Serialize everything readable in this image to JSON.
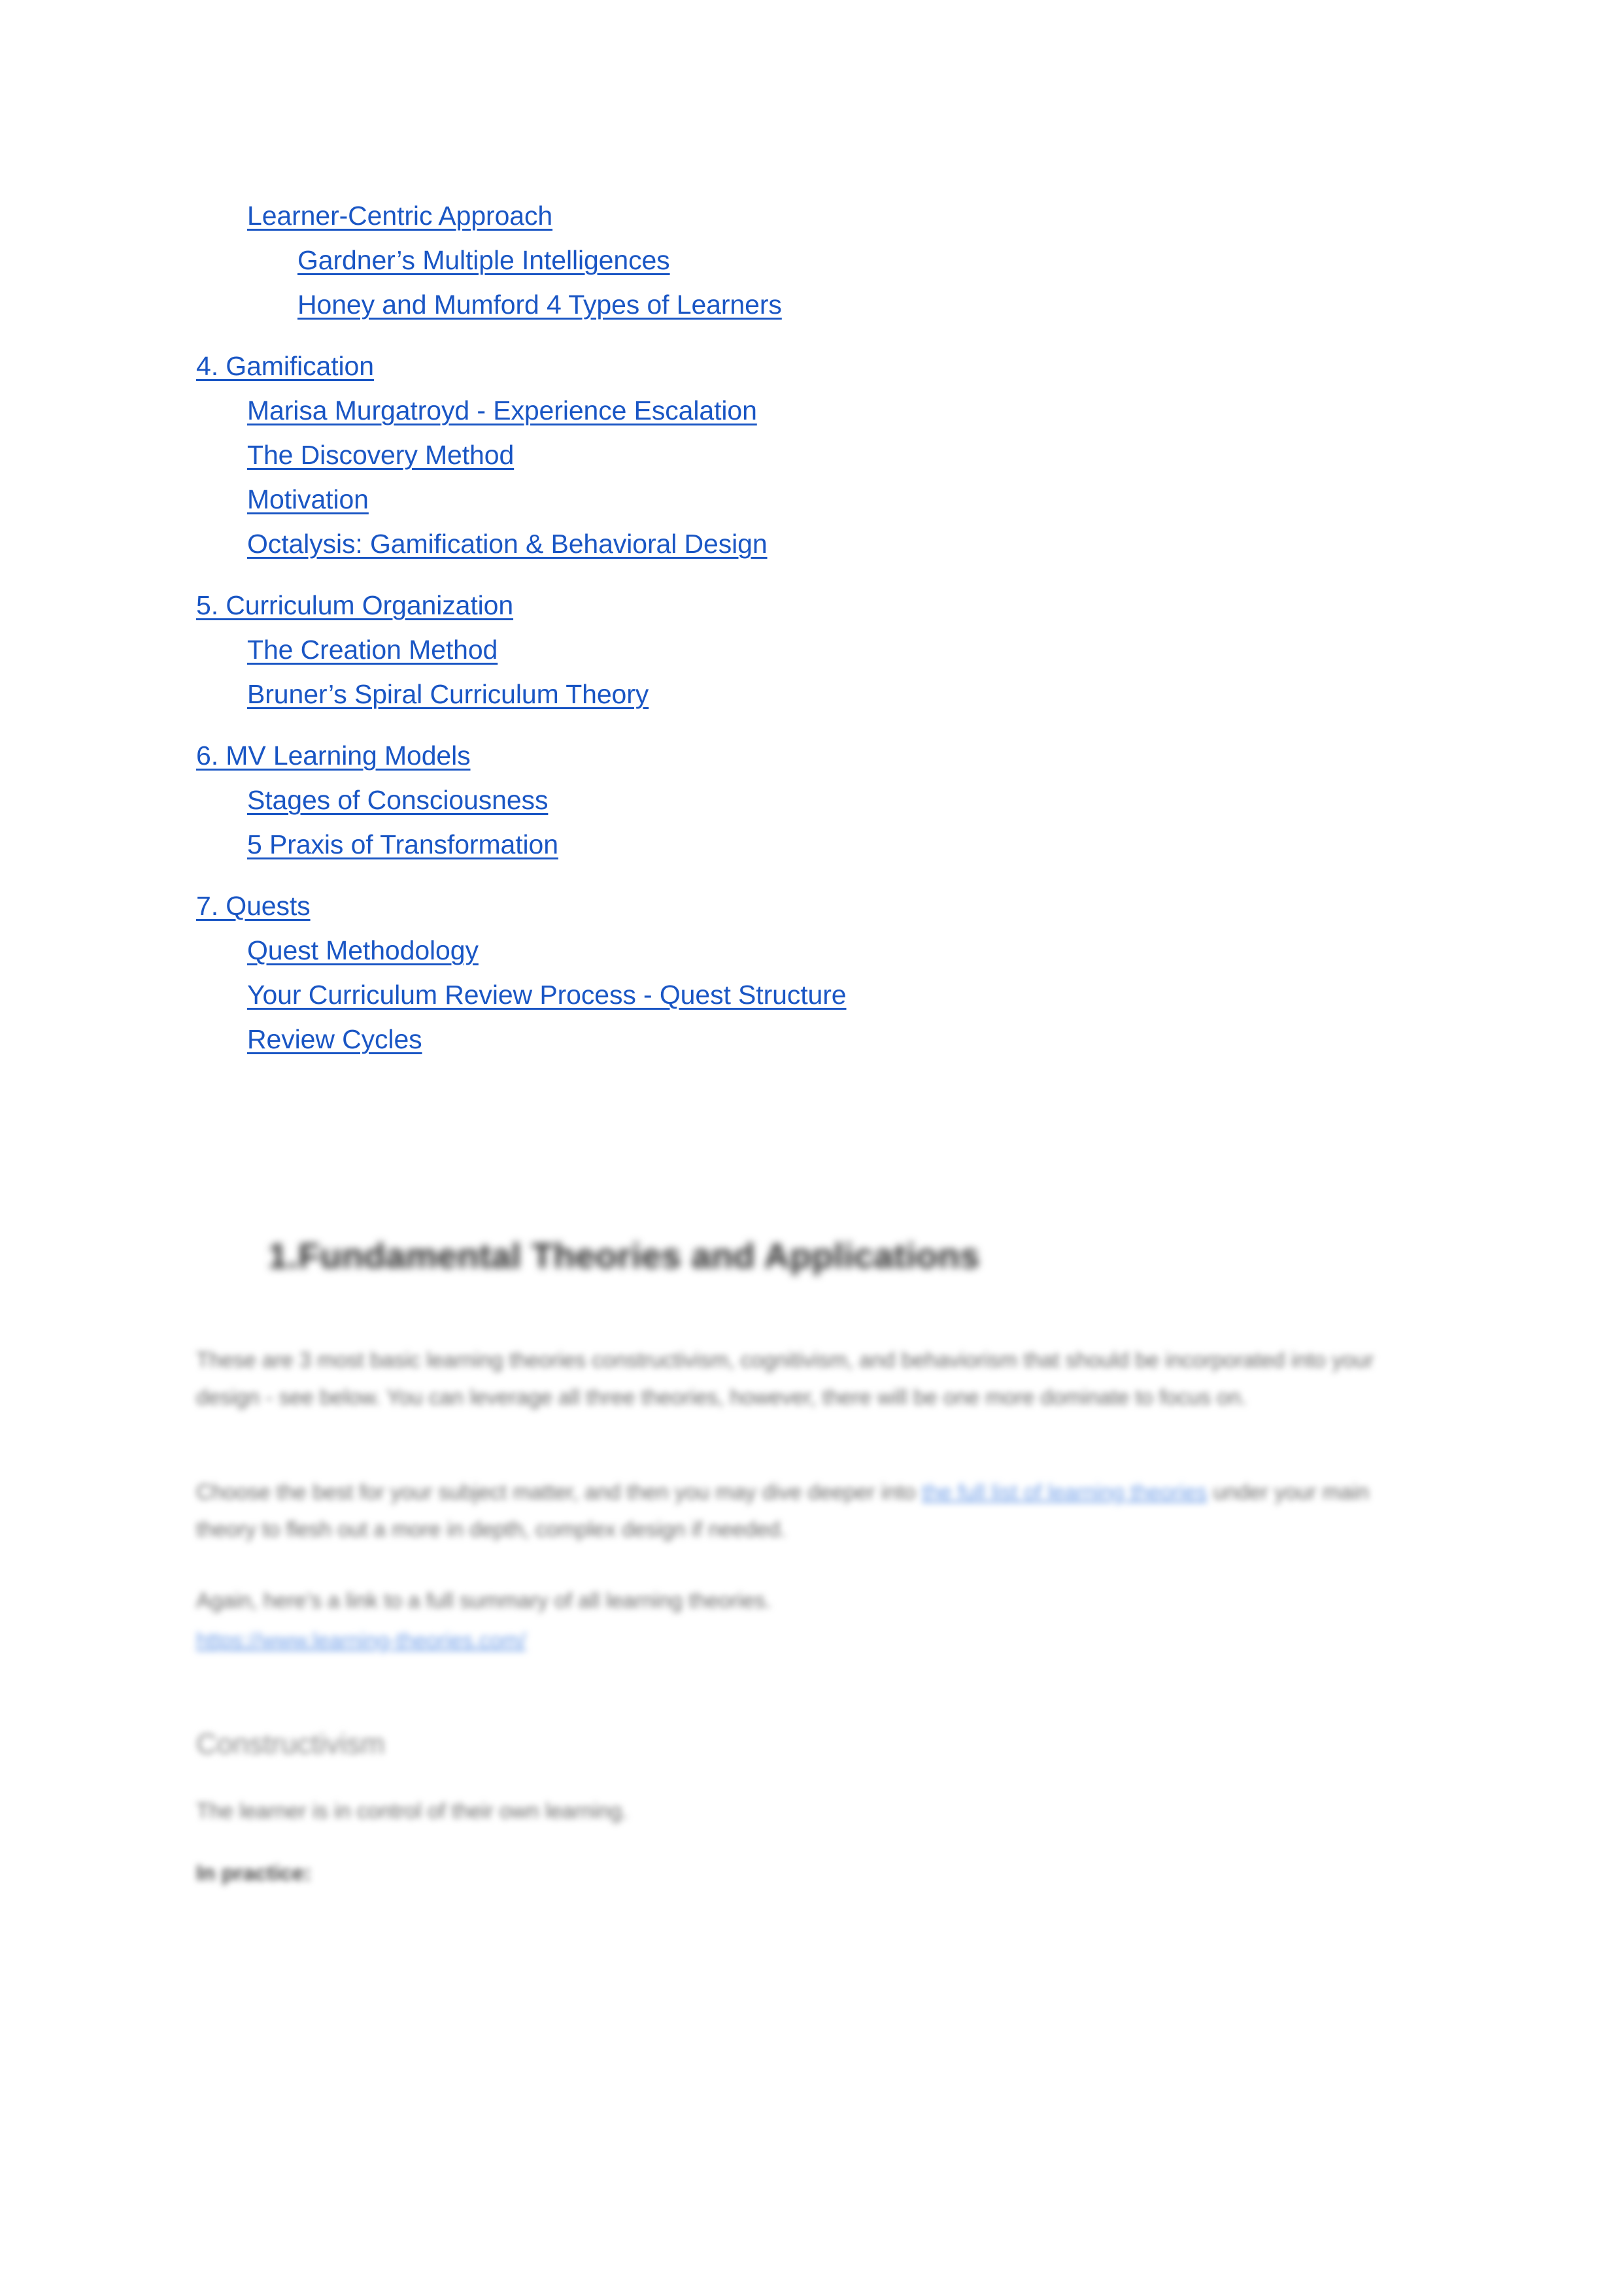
{
  "document": {
    "link_color": "#1a56c4",
    "background_color": "#ffffff",
    "body_text_color": "#6a6a6a"
  },
  "toc": {
    "groups": [
      {
        "items": [
          {
            "label": "Learner-Centric Approach",
            "level": 2
          },
          {
            "label": "Gardner’s Multiple Intelligences",
            "level": 3
          },
          {
            "label": "Honey and Mumford 4 Types of Learners",
            "level": 3
          }
        ]
      },
      {
        "items": [
          {
            "label": "4. Gamification",
            "level": 1
          },
          {
            "label": "Marisa Murgatroyd - Experience Escalation",
            "level": 2
          },
          {
            "label": "The Discovery Method",
            "level": 2
          },
          {
            "label": "Motivation",
            "level": 2
          },
          {
            "label": "Octalysis: Gamification & Behavioral Design",
            "level": 2
          }
        ]
      },
      {
        "items": [
          {
            "label": "5. Curriculum Organization",
            "level": 1
          },
          {
            "label": "The Creation Method",
            "level": 2
          },
          {
            "label": "Bruner’s Spiral Curriculum Theory",
            "level": 2
          }
        ]
      },
      {
        "items": [
          {
            "label": "6. MV Learning Models",
            "level": 1
          },
          {
            "label": "Stages of Consciousness",
            "level": 2
          },
          {
            "label": "5 Praxis of Transformation",
            "level": 2
          }
        ]
      },
      {
        "items": [
          {
            "label": "7. Quests",
            "level": 1
          },
          {
            "label": "Quest Methodology",
            "level": 2
          },
          {
            "label": "Your Curriculum Review Process - Quest Structure",
            "level": 2
          },
          {
            "label": "Review Cycles",
            "level": 2
          }
        ]
      }
    ]
  },
  "body": {
    "heading": "1.Fundamental Theories and Applications",
    "paragraph_1": "These are 3 most basic learning theories constructivism, cognitivism, and behaviorism that should be incorporated into your design - see below. You can leverage all three theories, however, there will be one more dominate to focus on.",
    "paragraph_2_before_link": "Choose the best for your subject matter, and then you may dive deeper into ",
    "paragraph_2_link": "the full list of learning theories",
    "paragraph_2_after_link": " under your main theory to flesh out a more in depth, complex design if needed.",
    "bold_note": "Again, here’s a link to a full summary of all learning theories.",
    "url": "https://www.learning-theories.com/",
    "subheading": "Constructivism",
    "subheading_line": "The learner is in control of their own learning.",
    "in_practice_label": "In practice:"
  }
}
